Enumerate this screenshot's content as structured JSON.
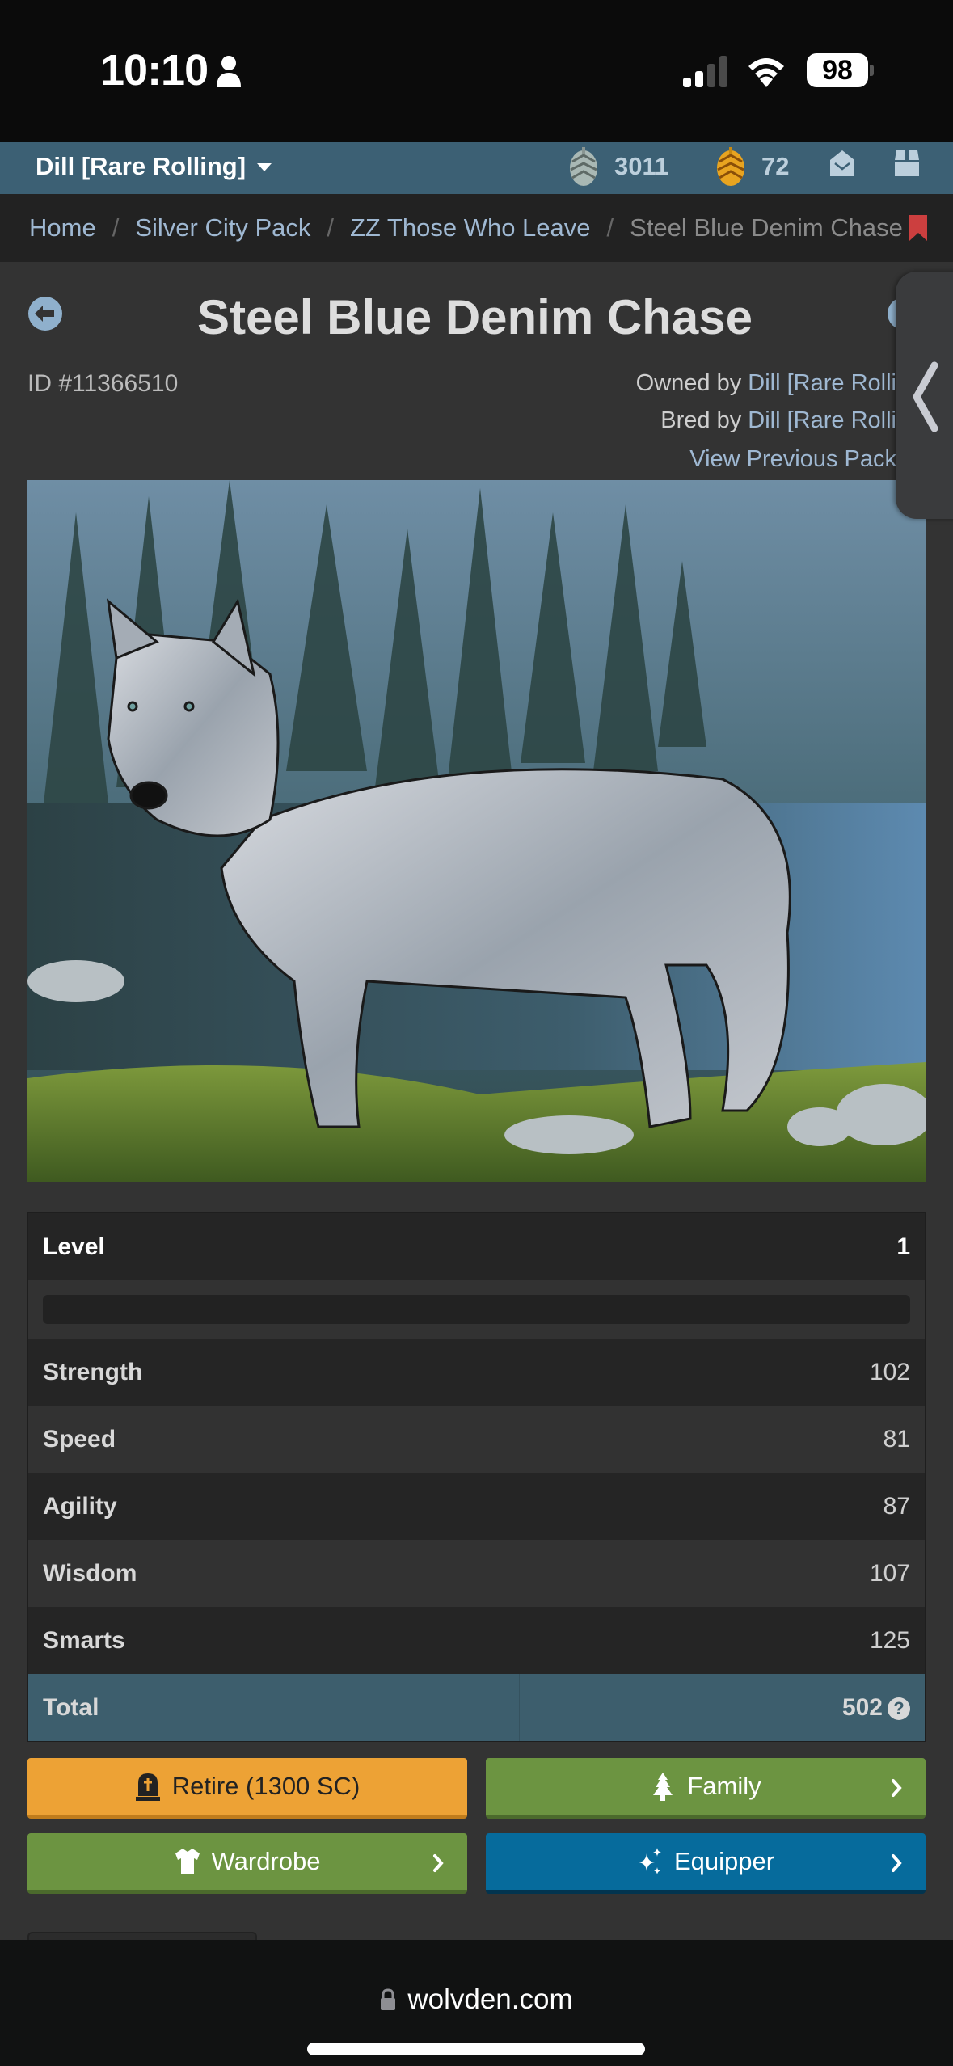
{
  "status_bar": {
    "time": "10:10",
    "battery": "98",
    "signal_bars_active": 2,
    "signal_bars_total": 4
  },
  "top_nav": {
    "user_menu_label": "Dill [Rare Rolling]",
    "silver_cones": "3011",
    "gold_cones": "72",
    "icons": [
      "silver-pinecone-icon",
      "gold-pinecone-icon",
      "mail-icon",
      "inventory-box-icon"
    ]
  },
  "breadcrumb": {
    "items": [
      {
        "label": "Home"
      },
      {
        "label": "Silver City Pack"
      },
      {
        "label": "ZZ Those Who Leave"
      }
    ],
    "current": "Steel Blue Denim Chase",
    "separator": "/"
  },
  "wolf": {
    "name": "Steel Blue Denim Chase",
    "id_label": "ID #11366510",
    "owned_by_prefix": "Owned by",
    "owner": "Dill [Rare Rolli",
    "bred_by_prefix": "Bred by",
    "breeder": "Dill [Rare Rolli",
    "previous_packs_link": "View Previous Pack"
  },
  "stats": {
    "level_label": "Level",
    "level": "1",
    "xp_progress_fraction": 0,
    "rows": [
      {
        "label": "Strength",
        "value": "102"
      },
      {
        "label": "Speed",
        "value": "81"
      },
      {
        "label": "Agility",
        "value": "87"
      },
      {
        "label": "Wisdom",
        "value": "107"
      },
      {
        "label": "Smarts",
        "value": "125"
      }
    ],
    "total_label": "Total",
    "total": "502",
    "help_glyph": "?"
  },
  "actions": {
    "retire": "Retire (1300 SC)",
    "family": "Family",
    "wardrobe": "Wardrobe",
    "equipper": "Equipper"
  },
  "colors": {
    "nav_bg": "#3c6074",
    "link": "#9fb8d2",
    "retire": "#eda235",
    "green": "#6c9441",
    "blue": "#066b9c",
    "total_row": "#3d5e6d"
  },
  "browser": {
    "domain": "wolvden.com"
  }
}
